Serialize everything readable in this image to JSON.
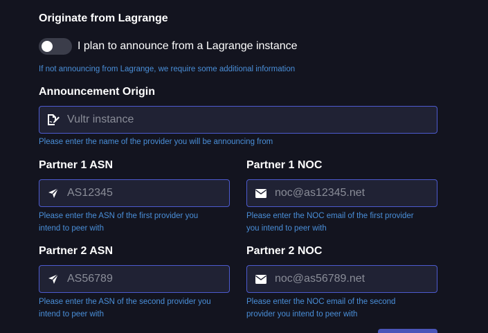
{
  "originate": {
    "title": "Originate from Lagrange",
    "toggle_label": "I plan to announce from a Lagrange instance",
    "toggle_on": false,
    "help": "If not announcing from Lagrange, we require some additional information"
  },
  "origin": {
    "title": "Announcement Origin",
    "placeholder": "Vultr instance",
    "value": "",
    "help": "Please enter the name of the provider you will be announcing from",
    "icon": "file-signature-icon"
  },
  "partner1_asn": {
    "title": "Partner 1 ASN",
    "placeholder": "AS12345",
    "value": "",
    "help_line1": "Please enter the ASN of the first provider you",
    "help_line2": "intend to peer with",
    "icon": "location-arrow-icon"
  },
  "partner1_noc": {
    "title": "Partner 1 NOC",
    "placeholder": "noc@as12345.net",
    "value": "",
    "help_line1": "Please enter the NOC email of the first provider",
    "help_line2": "you intend to peer with",
    "icon": "envelope-icon"
  },
  "partner2_asn": {
    "title": "Partner 2 ASN",
    "placeholder": "AS56789",
    "value": "",
    "help_line1": "Please enter the ASN of the second provider you",
    "help_line2": "intend to peer with",
    "icon": "location-arrow-icon"
  },
  "partner2_noc": {
    "title": "Partner 2 NOC",
    "placeholder": "noc@as56789.net",
    "value": "",
    "help_line1": "Please enter the NOC email of the second",
    "help_line2": "provider you intend to peer with",
    "icon": "envelope-icon"
  },
  "colors": {
    "background": "#13141f",
    "input_background": "#202234",
    "input_border": "#4d5bd0",
    "help_text": "#4a8fd9",
    "toggle_off": "#3b3d4a",
    "button": "#4a55b8"
  }
}
